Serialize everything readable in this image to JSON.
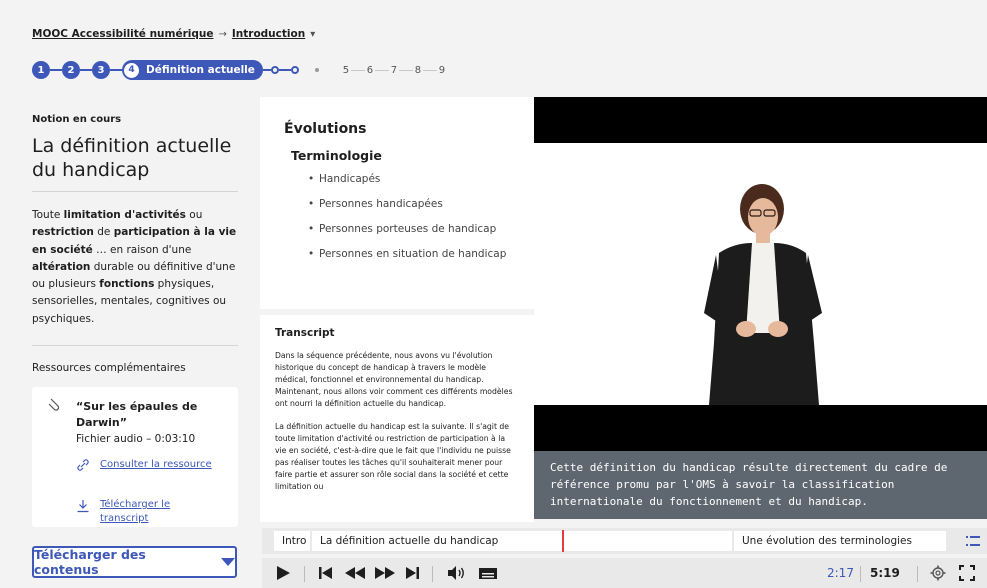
{
  "breadcrumb": {
    "course": "MOOC Accessibilité numérique",
    "arrow": "→",
    "section": "Introduction",
    "caret": "▾"
  },
  "steps": {
    "done": [
      "1",
      "2",
      "3"
    ],
    "current_num": "4",
    "current_label": "Définition actuelle",
    "upcoming": [
      "5",
      "6",
      "7",
      "8",
      "9"
    ]
  },
  "notion": {
    "label": "Notion en cours",
    "title": "La définition actuelle du handicap",
    "definition_parts": [
      {
        "t": "Toute ",
        "b": false
      },
      {
        "t": "limitation d'activités",
        "b": true
      },
      {
        "t": " ou ",
        "b": false
      },
      {
        "t": "restriction",
        "b": true
      },
      {
        "t": " de ",
        "b": false
      },
      {
        "t": "participation à la vie en société",
        "b": true
      },
      {
        "t": " … en raison d'une ",
        "b": false
      },
      {
        "t": "altération",
        "b": true
      },
      {
        "t": " durable ou définitive d'une ou plusieurs ",
        "b": false
      },
      {
        "t": "fonctions",
        "b": true
      },
      {
        "t": " physiques, sensorielles, mentales, cognitives ou psychiques.",
        "b": false
      }
    ]
  },
  "resources": {
    "label": "Ressources complémentaires",
    "title": "“Sur les épaules de Darwin”",
    "meta": "Fichier audio – 0:03:10",
    "consult": "Consulter la ressource",
    "download": "Télécharger le transcript"
  },
  "download_button": "Télécharger des contenus",
  "slide": {
    "heading": "Évolutions",
    "subheading": "Terminologie",
    "items": [
      "Handicapés",
      "Personnes handicapées",
      "Personnes porteuses de handicap",
      "Personnes en situation de handicap"
    ]
  },
  "transcript": {
    "title": "Transcript",
    "p1": "Dans la séquence précédente, nous avons vu l'évolution historique du concept de handicap à travers le modèle médical, fonctionnel et environnemental du handicap. Maintenant, nous allons voir comment ces différents modèles ont nourri la définition actuelle du handicap.",
    "p2": "La définition actuelle du handicap est la suivante. Il s'agit de toute limitation d'activité ou restriction de participation à la vie en société, c'est-à-dire que le fait que l'individu ne puisse pas réaliser toutes les tâches qu'il souhaiterait mener pour faire partie et assurer son rôle social dans la société et cette limitation ou"
  },
  "video": {
    "subtitle": "Cette définition du handicap résulte directement du cadre de référence promu par l'OMS à savoir la classification internationale du fonctionnement et du handicap."
  },
  "chapters": {
    "first": "Intro",
    "current": "La définition actuelle du handicap",
    "next": "Une évolution des terminologies"
  },
  "player": {
    "current_time": "2:17",
    "total_time": "5:19",
    "progress_fraction": 0.43
  },
  "colors": {
    "accent": "#3d58b8",
    "marker": "#e63946",
    "subtitle_bg": "#5e6770"
  }
}
